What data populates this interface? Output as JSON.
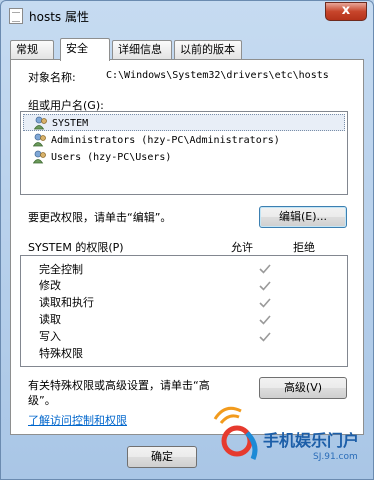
{
  "window": {
    "title": "hosts 属性",
    "close_glyph": "x"
  },
  "tabs": [
    {
      "label": "常规",
      "active": false
    },
    {
      "label": "安全",
      "active": true
    },
    {
      "label": "详细信息",
      "active": false
    },
    {
      "label": "以前的版本",
      "active": false
    }
  ],
  "security": {
    "object_name_label": "对象名称:",
    "object_name_value": "C:\\Windows\\System32\\drivers\\etc\\hosts",
    "group_label": "组或用户名(G):",
    "users": [
      {
        "name": "SYSTEM",
        "selected": true
      },
      {
        "name": "Administrators (hzy-PC\\Administrators)",
        "selected": false
      },
      {
        "name": "Users (hzy-PC\\Users)",
        "selected": false
      }
    ],
    "change_perm_text": "要更改权限，请单击“编辑”。",
    "edit_button": "编辑(E)...",
    "perm_title": "SYSTEM 的权限(P)",
    "allow_header": "允许",
    "deny_header": "拒绝",
    "permissions": [
      {
        "name": "完全控制",
        "allow": true
      },
      {
        "name": "修改",
        "allow": true
      },
      {
        "name": "读取和执行",
        "allow": true
      },
      {
        "name": "读取",
        "allow": true
      },
      {
        "name": "写入",
        "allow": true
      },
      {
        "name": "特殊权限",
        "allow": false
      }
    ],
    "advanced_text_1": "有关特殊权限或高级设置，请单击“高",
    "advanced_text_2": "级”。",
    "advanced_button": "高级(V)",
    "learn_link": "了解访问控制和权限"
  },
  "footer": {
    "ok_button": "确定"
  },
  "watermark": {
    "name": "手机娱乐门户",
    "url": "SJ.91.com"
  },
  "colors": {
    "titlebar": "#b9d1ea",
    "close": "#c7452b",
    "link": "#0066cc"
  }
}
